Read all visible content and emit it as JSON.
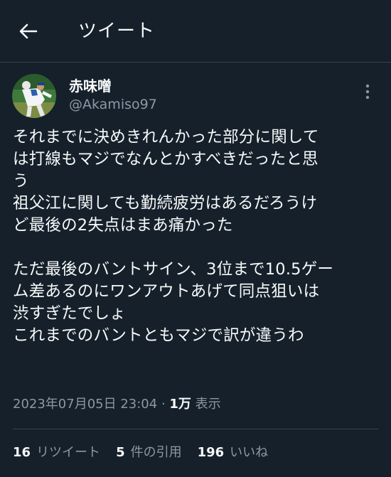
{
  "header": {
    "title": "ツイート",
    "back_icon": "back-arrow-icon"
  },
  "author": {
    "name": "赤味噌",
    "handle": "@Akamiso97",
    "avatar_icon": "avatar-baseball-pitcher"
  },
  "tweet": {
    "text": "それまでに決めきれんかった部分に関して\nは打線もマジでなんとかすべきだったと思\nう\n祖父江に関しても勤続疲労はあるだろうけ\nど最後の2失点はまあ痛かった\n\nただ最後のバントサイン、3位まで10.5ゲー\nム差あるのにワンアウトあげて同点狙いは\n渋すぎたでしょ\nこれまでのバントともマジで訳が違うわ"
  },
  "meta": {
    "timestamp": "2023年07月05日 23:04",
    "separator": " · ",
    "views_count": "1万",
    "views_label": "表示"
  },
  "stats": {
    "retweets_count": "16",
    "retweets_label": "リツイート",
    "quotes_count": "5",
    "quotes_label": "件の引用",
    "likes_count": "196",
    "likes_label": "いいね"
  },
  "colors": {
    "background": "#15202b",
    "text_primary": "#f7f9f9",
    "text_secondary": "#8b98a5",
    "border": "#38444d"
  }
}
